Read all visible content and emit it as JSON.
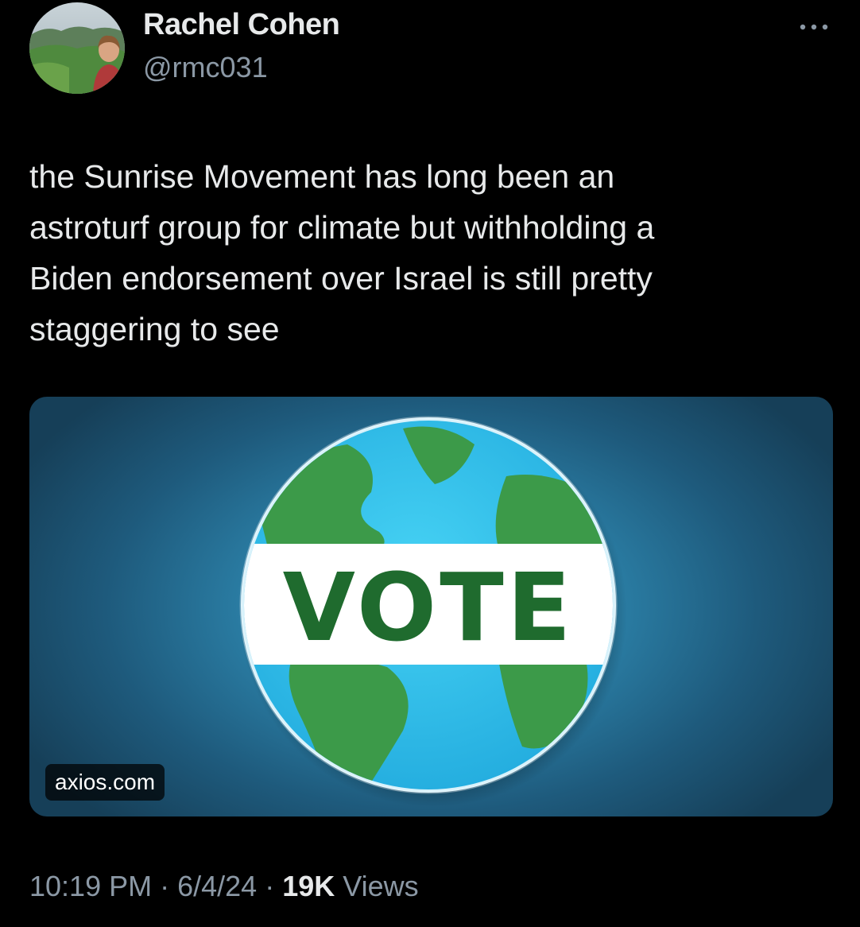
{
  "author": {
    "name": "Rachel Cohen",
    "handle": "@rmc031",
    "avatar_icon": "profile-photo"
  },
  "more_icon": "ellipsis-icon",
  "tweet": {
    "text": "the Sunrise Movement has long been an\nastroturf group for climate but withholding a\nBiden endorsement over Israel is still pretty\nstaggering to see"
  },
  "media": {
    "button_label": "VOTE",
    "domain": "axios.com",
    "colors": {
      "ocean": "#38c4ea",
      "land": "#3c9a49",
      "band": "#ffffff",
      "text_green": "#1f6b2e",
      "text_blue": "#1b73b7"
    }
  },
  "meta": {
    "time": "10:19 PM",
    "sep1": " · ",
    "date": "6/4/24",
    "sep2": " · ",
    "views_count": "19K",
    "views_label": " Views"
  },
  "colors": {
    "background": "#000000",
    "primary_text": "#e7e9ea",
    "secondary_text": "#8b98a5"
  }
}
